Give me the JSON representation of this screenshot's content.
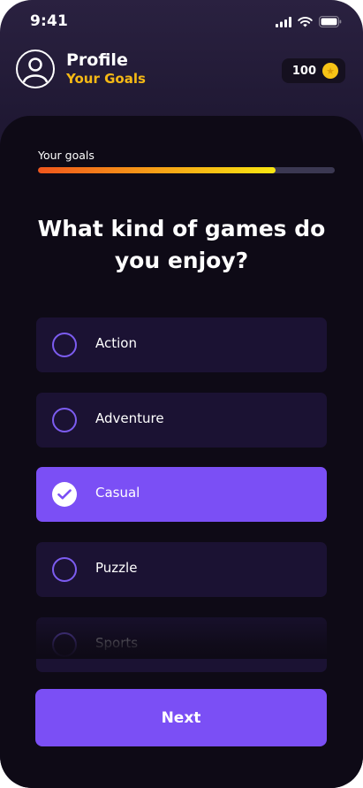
{
  "status_bar": {
    "time": "9:41",
    "icons": [
      "cellular-signal-icon",
      "wifi-icon",
      "battery-icon"
    ]
  },
  "header": {
    "title": "Profile",
    "subtitle": "Your Goals",
    "avatar_icon": "user-avatar-icon",
    "coins": "100",
    "coin_icon": "star-coin-icon"
  },
  "progress": {
    "label": "Your goals",
    "value": 0.8
  },
  "question": "What kind of games do you enjoy?",
  "options": [
    {
      "label": "Action",
      "selected": false
    },
    {
      "label": "Adventure",
      "selected": false
    },
    {
      "label": "Casual",
      "selected": true
    },
    {
      "label": "Puzzle",
      "selected": false
    },
    {
      "label": "Sports",
      "selected": false
    }
  ],
  "next_button": {
    "label": "Next"
  },
  "colors": {
    "accent": "#7b4ff5",
    "highlight": "#f5b915",
    "sheet": "#0e0a16",
    "option_bg": "#1b1233"
  }
}
